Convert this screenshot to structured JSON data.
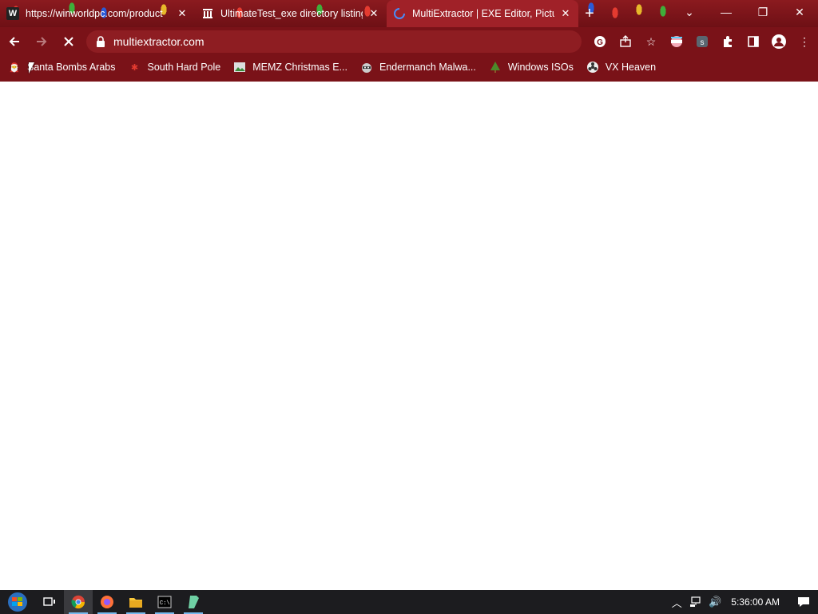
{
  "tabs": [
    {
      "title": "https://winworldpc.com/product",
      "favicon": "W",
      "active": false
    },
    {
      "title": "UltimateTest_exe directory listing",
      "favicon": "archive-icon",
      "active": false
    },
    {
      "title": "MultiExtractor | EXE Editor, Pictur",
      "favicon": "loading-icon",
      "active": true
    }
  ],
  "window_controls": {
    "tab_search": "⌄",
    "minimize": "—",
    "restore": "❐",
    "close": "✕"
  },
  "address_bar": {
    "url": "multiextractor.com"
  },
  "bookmarks": [
    {
      "label": "Santa Bombs Arabs"
    },
    {
      "label": "South Hard Pole"
    },
    {
      "label": "MEMZ Christmas E..."
    },
    {
      "label": "Endermanch Malwa..."
    },
    {
      "label": "Windows ISOs"
    },
    {
      "label": "VX Heaven"
    }
  ],
  "taskbar": {
    "clock": "5:36:00 AM"
  },
  "colors": {
    "chrome": "#7a1218",
    "active_tab": "#a02128",
    "taskbar": "#1c1c1f"
  }
}
